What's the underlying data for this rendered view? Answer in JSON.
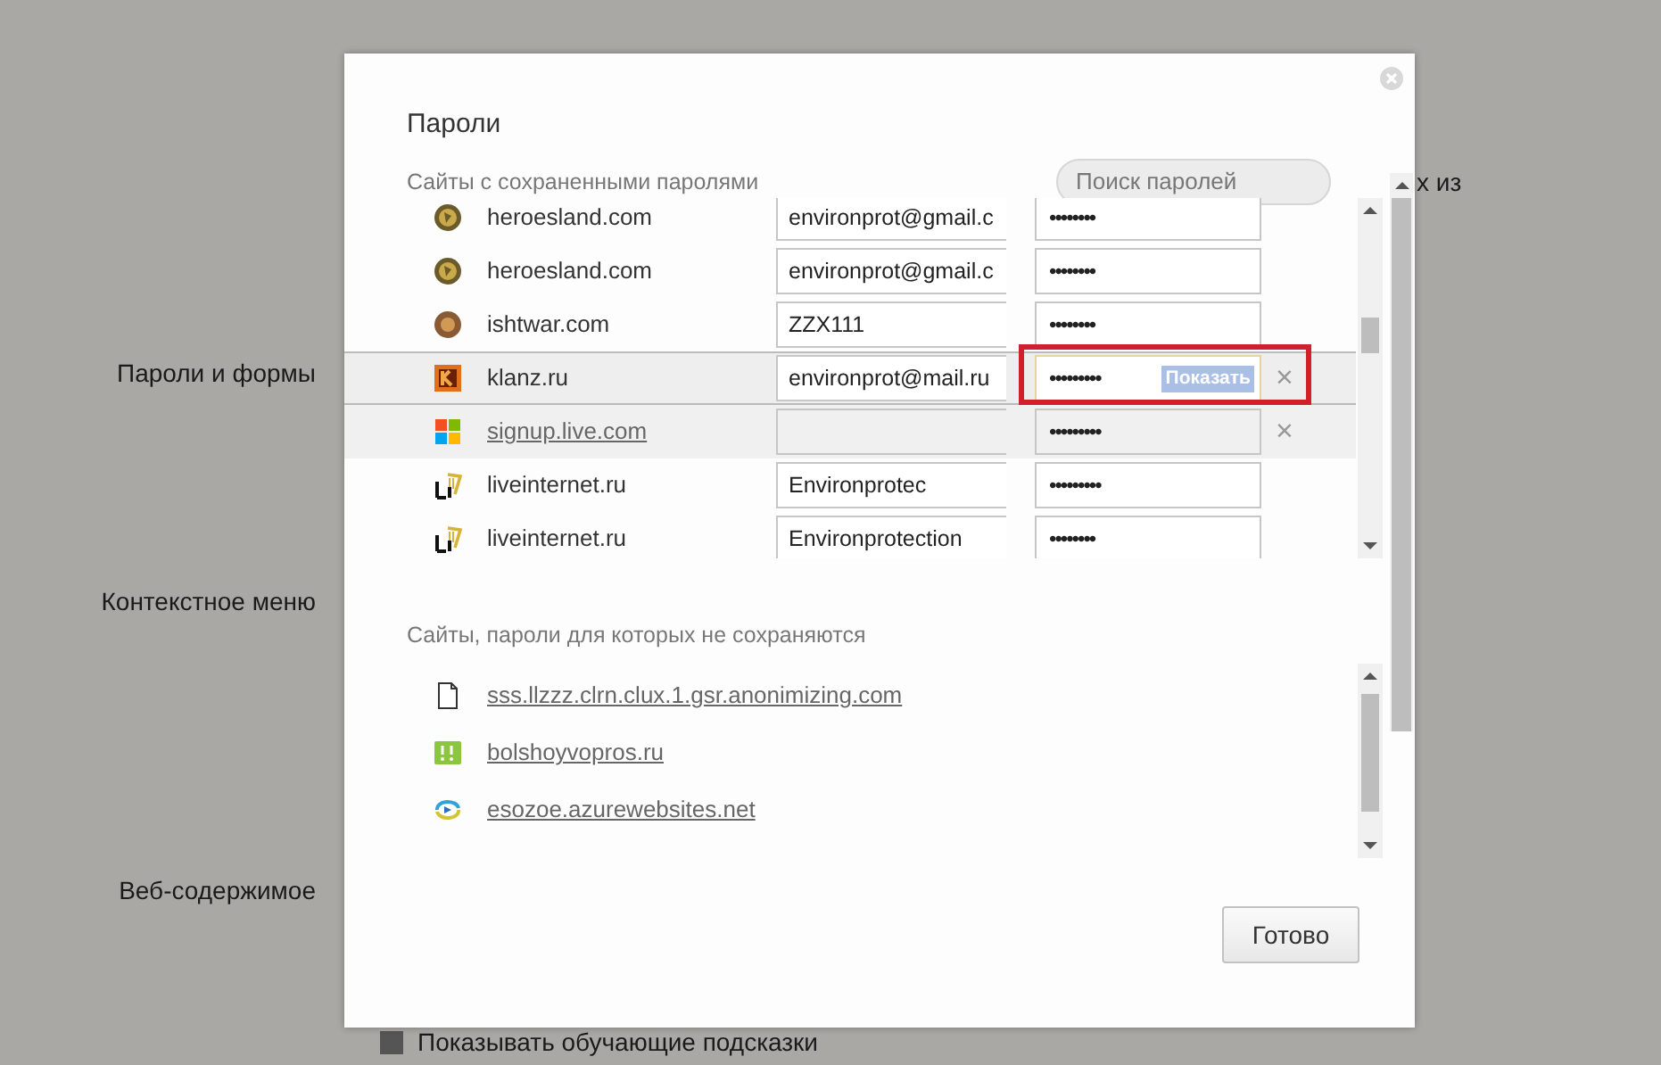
{
  "background": {
    "sections": [
      {
        "label": "Пароли и формы"
      },
      {
        "label": "Контекстное меню"
      },
      {
        "label": "Веб-содержимое"
      }
    ],
    "side_text": "х из",
    "tips_checkbox": {
      "label": "Показывать обучающие подсказки",
      "checked": true
    }
  },
  "dialog": {
    "title": "Пароли",
    "search": {
      "placeholder": "Поиск паролей"
    },
    "saved": {
      "heading": "Сайты с сохраненными паролями",
      "rows": [
        {
          "kind": "coin",
          "site": "heroesland.com",
          "username": "environprot@gmail.c",
          "password": "••••••••",
          "selected": false,
          "hovered": false
        },
        {
          "kind": "coin",
          "site": "heroesland.com",
          "username": "environprot@gmail.c",
          "password": "••••••••",
          "selected": false,
          "hovered": false
        },
        {
          "kind": "round",
          "site": "ishtwar.com",
          "username": "ZZX111",
          "password": "••••••••",
          "selected": false,
          "hovered": false
        },
        {
          "kind": "ktile",
          "site": "klanz.ru",
          "username": "environprot@mail.ru",
          "password": "•••••••••",
          "selected": true,
          "hovered": false,
          "reveal_label": "Показать",
          "annotated": true,
          "delete": "×"
        },
        {
          "kind": "tiles",
          "site": "signup.live.com",
          "password": "•••••••••",
          "selected": false,
          "hovered": true,
          "delete": "×"
        },
        {
          "kind": "li",
          "site": "liveinternet.ru",
          "username": "Environprotec",
          "password": "•••••••••",
          "selected": false,
          "hovered": false
        },
        {
          "kind": "li",
          "site": "liveinternet.ru",
          "username": "Environprotection",
          "password": "••••••••",
          "selected": false,
          "hovered": false
        }
      ]
    },
    "never": {
      "heading": "Сайты, пароли для которых не сохраняются",
      "rows": [
        {
          "kind": "page",
          "site": "sss.llzzz.clrn.clux.1.gsr.anonimizing.com"
        },
        {
          "kind": "exclaim",
          "site": "bolshoyvopros.ru"
        },
        {
          "kind": "swirl",
          "site": "esozoe.azurewebsites.net"
        }
      ]
    },
    "done_button": "Готово"
  }
}
